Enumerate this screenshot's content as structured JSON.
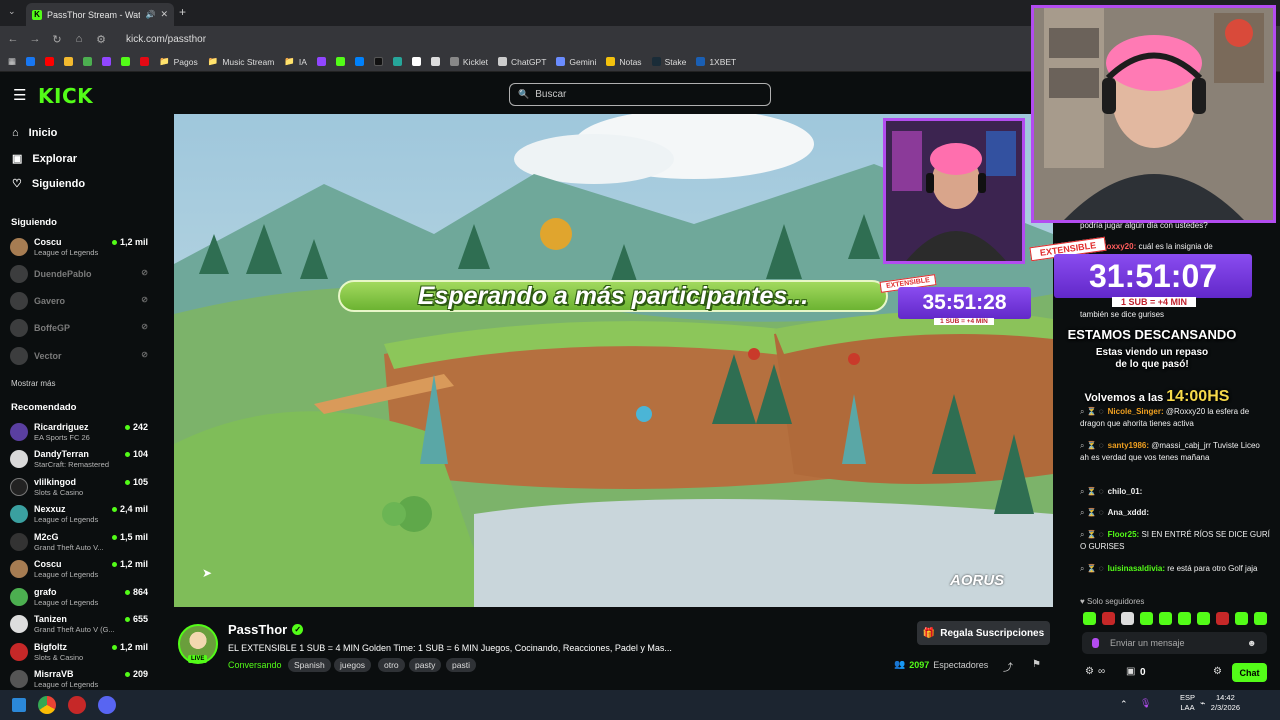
{
  "browser": {
    "tab_title": "PassThor Stream - Watch Li",
    "url": "kick.com/passthor",
    "bookmarks": [
      "Pagos",
      "Music Stream",
      "IA",
      "Kicklet",
      "ChatGPT",
      "Gemini",
      "Notas",
      "Stake",
      "1XBET"
    ]
  },
  "header": {
    "logo": "KICK",
    "search_placeholder": "Buscar"
  },
  "sidebar": {
    "nav": [
      {
        "label": "Inicio",
        "icon": "home-icon"
      },
      {
        "label": "Explorar",
        "icon": "compass-icon"
      },
      {
        "label": "Siguiendo",
        "icon": "heart-icon"
      }
    ],
    "following_title": "Siguiendo",
    "following": [
      {
        "name": "Coscu",
        "game": "League of Legends",
        "viewers": "1,2 mil",
        "live": true
      },
      {
        "name": "DuendePablo",
        "live": false
      },
      {
        "name": "Gavero",
        "live": false
      },
      {
        "name": "BoffeGP",
        "live": false
      },
      {
        "name": "Vector",
        "live": false
      }
    ],
    "show_more": "Mostrar más",
    "recommended_title": "Recomendado",
    "recommended": [
      {
        "name": "Ricardriguez",
        "game": "EA Sports FC 26",
        "viewers": "242"
      },
      {
        "name": "DandyTerran",
        "game": "StarCraft: Remastered",
        "viewers": "104"
      },
      {
        "name": "vlilkingod",
        "game": "Slots & Casino",
        "viewers": "105"
      },
      {
        "name": "Nexxuz",
        "game": "League of Legends",
        "viewers": "2,4 mil"
      },
      {
        "name": "M2cG",
        "game": "Grand Theft Auto V...",
        "viewers": "1,5 mil"
      },
      {
        "name": "Coscu",
        "game": "League of Legends",
        "viewers": "1,2 mil"
      },
      {
        "name": "grafo",
        "game": "League of Legends",
        "viewers": "864"
      },
      {
        "name": "Tanizen",
        "game": "Grand Theft Auto V (G...",
        "viewers": "655"
      },
      {
        "name": "Bigfoltz",
        "game": "Slots & Casino",
        "viewers": "1,2 mil"
      },
      {
        "name": "MisrraVB",
        "game": "League of Legends",
        "viewers": "209"
      }
    ]
  },
  "video": {
    "banner": "Esperando a más participantes...",
    "extensible": "EXTENSIBLE",
    "timer_small": "35:51:28",
    "sub_rule_small": "1 SUB = +4 MIN",
    "timer_big": "31:51:07",
    "sub_rule_big": "1 SUB = +4 MIN",
    "brand": "AORUS",
    "overlay_break": "ESTAMOS DESCANSANDO",
    "overlay_recap_1": "Estas viendo un repaso",
    "overlay_recap_2": "de lo que pasó!",
    "overlay_return_prefix": "Volvemos a las",
    "overlay_return_time": "14:00HS"
  },
  "stream": {
    "streamer": "PassThor",
    "live_badge": "LIVE",
    "title": "EL EXTENSIBLE 1 SUB = 4 MIN Golden Time: 1 SUB = 6 MIN Juegos, Cocinando, Reacciones, Padel y Mas...",
    "category": "Conversando",
    "tags": [
      "Spanish",
      "juegos",
      "otro",
      "pasty",
      "pasti"
    ],
    "gift_label": "Regala Suscripciones",
    "viewer_count": "2097",
    "viewer_label": "Espectadores"
  },
  "chat": {
    "messages": [
      {
        "user": "",
        "text": "podría jugar algún día con ustedes?"
      },
      {
        "user": "Roxxy20:",
        "text": "cuál es la insignia de"
      },
      {
        "user": "",
        "text": "también se dice gurises"
      },
      {
        "user": "Nicole_Singer:",
        "text": "@Roxxy20 la esfera de dragon que ahorita tienes activa",
        "color": "#f0a020"
      },
      {
        "user": "santy1986:",
        "text": "@massi_cabj_jrr Tuviste Liceo ah es verdad que vos tenes mañana",
        "color": "#f0a020"
      },
      {
        "user": "chilo_01:",
        "text": "",
        "color": "#ffffff"
      },
      {
        "user": "Ana_xddd:",
        "text": "",
        "color": "#ffffff"
      },
      {
        "user": "Floor25:",
        "text": "SI EN ENTRÉ RÍOS SE DICE GURÍ O GURISES",
        "color": "#53fc18"
      },
      {
        "user": "luisinasaldivia:",
        "text": "re está para otro Golf jaja",
        "color": "#53fc18"
      }
    ],
    "followers_only": "Solo seguidores",
    "input_placeholder": "Enviar un mensaje",
    "points": "0",
    "send_label": "Chat"
  },
  "taskbar": {
    "lang_1": "ESP",
    "lang_2": "LAA",
    "time": "14:42",
    "date": "2/3/2026"
  }
}
